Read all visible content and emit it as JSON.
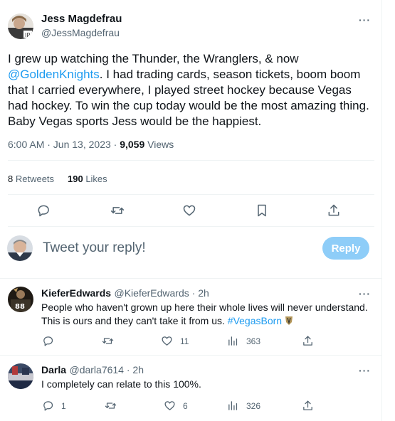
{
  "tweet": {
    "author_name": "Jess Magdefrau",
    "author_handle": "@JessMagdefrau",
    "text_before": "I grew up watching the Thunder, the Wranglers, & now ",
    "mention": "@GoldenKnights",
    "text_after": ". I had trading cards, season tickets, boom boom that I carried everywhere, I played street hockey because Vegas had hockey. To win the cup today would be the most amazing thing. Baby Vegas sports Jess would be the happiest.",
    "time": "6:00 AM · Jun 13, 2023 · ",
    "views_count": "9,059",
    "views_label": " Views",
    "retweets_count": "8",
    "retweets_label": " Retweets",
    "likes_count": "190",
    "likes_label": " Likes",
    "more_label": "···"
  },
  "composer": {
    "placeholder": "Tweet your reply!",
    "reply_label": "Reply"
  },
  "replies": [
    {
      "name": "KieferEdwards",
      "handle": "@KieferEdwards · 2h",
      "text": "People who haven't grown up here their whole lives will never understand. This is ours and they can't take it from us. ",
      "hashtag": "#VegasBorn",
      "reply_count": "",
      "retweet_count": "",
      "like_count": "11",
      "view_count": "363"
    },
    {
      "name": "Darla",
      "handle": "@darla7614 · 2h",
      "text": "I completely can relate to this 100%.",
      "reply_count": "1",
      "retweet_count": "",
      "like_count": "6",
      "view_count": "326"
    }
  ],
  "icons": {
    "reply": "reply-icon",
    "retweet": "retweet-icon",
    "like": "heart-icon",
    "bookmark": "bookmark-icon",
    "share": "share-icon",
    "views": "views-icon",
    "shield": "vgk-shield-icon"
  },
  "colors": {
    "accent": "#1d9bf0",
    "reply_button": "#8ecdf8",
    "muted": "#536471",
    "text": "#0f1419"
  }
}
